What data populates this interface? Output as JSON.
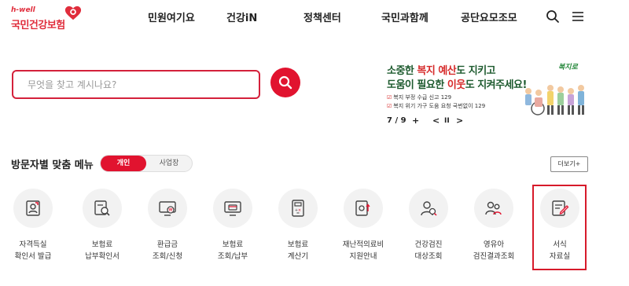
{
  "header": {
    "logo_sub": "h-well",
    "logo_main": "국민건강보험",
    "nav": [
      "민원여기요",
      "건강iN",
      "정책센터",
      "국민과함께",
      "공단요모조모"
    ]
  },
  "search": {
    "placeholder": "무엇을 찾고 계시나요?"
  },
  "banner": {
    "line1_a": "소중한 ",
    "line1_hl": "복지 예산",
    "line1_b": "도 지키고",
    "line2_a": "도움이 필요한 ",
    "line2_hl": "이웃",
    "line2_b": "도 지켜주세요!",
    "small1": "복지 부정 수급 신고 129",
    "small2": "복지 위기 가구 도움 요청 국번없이 129",
    "logo": "복지로",
    "page": "7 / 9",
    "plus": "+",
    "prev": "<",
    "pause": "II",
    "next": ">"
  },
  "section": {
    "title": "방문자별 맞춤 메뉴",
    "toggle_active": "개인",
    "toggle_inactive": "사업장",
    "more": "더보기+"
  },
  "menu": [
    {
      "l1": "자격득실",
      "l2": "확인서 발급",
      "icon": "certificate-icon"
    },
    {
      "l1": "보험료",
      "l2": "납부확인서",
      "icon": "document-search-icon"
    },
    {
      "l1": "환급금",
      "l2": "조회/신청",
      "icon": "refund-monitor-icon"
    },
    {
      "l1": "보험료",
      "l2": "조회/납부",
      "icon": "payment-monitor-icon"
    },
    {
      "l1": "보험료",
      "l2": "계산기",
      "icon": "calculator-icon"
    },
    {
      "l1": "재난적의료비",
      "l2": "지원안내",
      "icon": "medical-support-icon"
    },
    {
      "l1": "건강검진",
      "l2": "대상조회",
      "icon": "health-checkup-icon"
    },
    {
      "l1": "영유아",
      "l2": "검진결과조회",
      "icon": "infant-checkup-icon"
    },
    {
      "l1": "서식",
      "l2": "자료실",
      "icon": "forms-library-icon"
    }
  ]
}
